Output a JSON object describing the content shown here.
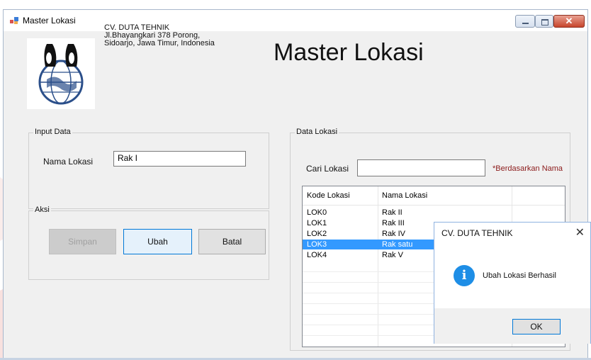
{
  "window": {
    "title": "Master Lokasi"
  },
  "company": {
    "name": "CV. DUTA TEHNIK",
    "address_line1": "Jl.Bhayangkari 378 Porong,",
    "address_line2": "Sidoarjo, Jawa Timur, Indonesia"
  },
  "page_title": "Master Lokasi",
  "input_group": {
    "legend": "Input Data",
    "nama_lokasi_label": "Nama Lokasi",
    "nama_lokasi_value": "Rak I"
  },
  "aksi_group": {
    "legend": "Aksi",
    "simpan": "Simpan",
    "ubah": "Ubah",
    "batal": "Batal"
  },
  "data_group": {
    "legend": "Data Lokasi",
    "cari_label": "Cari Lokasi",
    "cari_value": "",
    "note": "*Berdasarkan Nama",
    "columns": [
      "Kode Lokasi",
      "Nama Lokasi"
    ],
    "rows": [
      {
        "kode": "LOK0",
        "nama": "Rak II"
      },
      {
        "kode": "LOK1",
        "nama": "Rak III"
      },
      {
        "kode": "LOK2",
        "nama": "Rak IV"
      },
      {
        "kode": "LOK3",
        "nama": "Rak satu"
      },
      {
        "kode": "LOK4",
        "nama": "Rak V"
      }
    ],
    "selected_row": 3
  },
  "message_box": {
    "title": "CV. DUTA TEHNIK",
    "icon": "info-icon",
    "message": "Ubah Lokasi Berhasil",
    "ok": "OK"
  },
  "colors": {
    "selection": "#3399ff",
    "note": "#8b1a1a",
    "info_icon": "#1e8ee6"
  }
}
